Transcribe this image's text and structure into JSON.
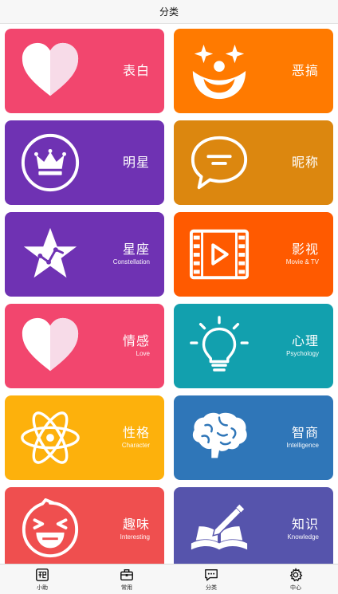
{
  "navbar": {
    "title": "分类"
  },
  "categories": [
    {
      "zh": "表白",
      "en": "",
      "color": "#f2466e",
      "icon": "heart-icon"
    },
    {
      "zh": "恶搞",
      "en": "",
      "color": "#ff7a00",
      "icon": "clown-face-icon"
    },
    {
      "zh": "明星",
      "en": "",
      "color": "#6f32b3",
      "icon": "crown-icon"
    },
    {
      "zh": "昵称",
      "en": "",
      "color": "#dc870f",
      "icon": "speech-bubble-icon"
    },
    {
      "zh": "星座",
      "en": "Constellation",
      "color": "#6f32b3",
      "icon": "star-constellation-icon"
    },
    {
      "zh": "影视",
      "en": "Movie & TV",
      "color": "#ff5a00",
      "icon": "film-play-icon"
    },
    {
      "zh": "情感",
      "en": "Love",
      "color": "#f2466e",
      "icon": "heart-icon"
    },
    {
      "zh": "心理",
      "en": "Psychology",
      "color": "#12a0ae",
      "icon": "lightbulb-icon"
    },
    {
      "zh": "性格",
      "en": "Character",
      "color": "#fdb10c",
      "icon": "atom-icon"
    },
    {
      "zh": "智商",
      "en": "Intelligence",
      "color": "#2f76b8",
      "icon": "brain-icon"
    },
    {
      "zh": "趣味",
      "en": "Interesting",
      "color": "#ef4f4f",
      "icon": "laughing-face-icon"
    },
    {
      "zh": "知识",
      "en": "Knowledge",
      "color": "#5654ac",
      "icon": "book-pen-icon"
    }
  ],
  "tabbar": {
    "items": [
      {
        "label": "小助",
        "icon": "helper-icon"
      },
      {
        "label": "常用",
        "icon": "toolbox-icon"
      },
      {
        "label": "分类",
        "icon": "chat-list-icon"
      },
      {
        "label": "中心",
        "icon": "gear-icon"
      }
    ]
  }
}
